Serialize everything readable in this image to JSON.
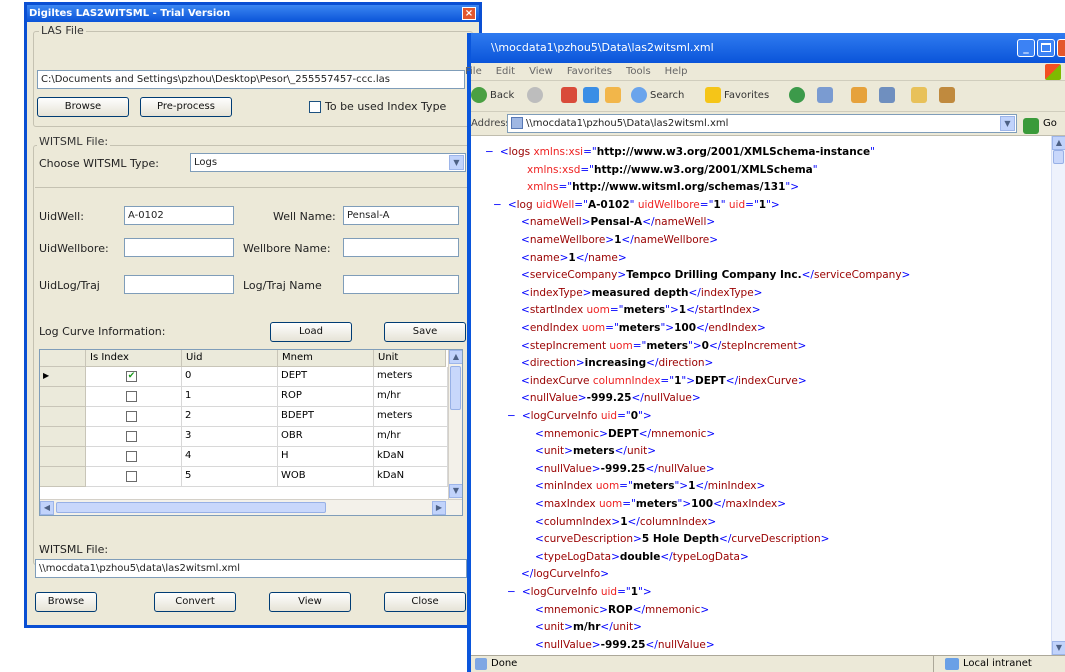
{
  "dialog": {
    "title": "Digiltes LAS2WITSML - Trial Version",
    "close_glyph": "×",
    "las_file": {
      "group_label": "LAS File",
      "path_value": "C:\\Documents and Settings\\pzhou\\Desktop\\Pesor\\_255557457-ccc.las",
      "browse_label": "Browse",
      "preprocess_label": "Pre-process",
      "checkbox_label": "To be used Index Type"
    },
    "witsml_file": {
      "group_label": "WITSML File:",
      "type_label": "Choose WITSML Type:",
      "type_value": "Logs",
      "uid_well_label": "UidWell:",
      "uid_well_value": "A-0102",
      "well_name_label": "Well Name:",
      "well_name_value": "Pensal-A",
      "uid_wellbore_label": "UidWellbore:",
      "uid_wellbore_value": "",
      "wellbore_name_label": "Wellbore Name:",
      "wellbore_name_value": "",
      "uid_logtraj_label": "UidLog/Traj",
      "uid_logtraj_value": "",
      "logtraj_name_label": "Log/Traj Name",
      "logtraj_name_value": ""
    },
    "curve_info": {
      "label": "Log Curve Information:",
      "load_label": "Load",
      "save_label": "Save",
      "columns": [
        "Is Index",
        "Uid",
        "Mnem",
        "Unit"
      ],
      "rows": [
        {
          "selected": true,
          "is_index": true,
          "uid": "0",
          "mnem": "DEPT",
          "unit": "meters"
        },
        {
          "selected": false,
          "is_index": false,
          "uid": "1",
          "mnem": "ROP",
          "unit": "m/hr"
        },
        {
          "selected": false,
          "is_index": false,
          "uid": "2",
          "mnem": "BDEPT",
          "unit": "meters"
        },
        {
          "selected": false,
          "is_index": false,
          "uid": "3",
          "mnem": "OBR",
          "unit": "m/hr"
        },
        {
          "selected": false,
          "is_index": false,
          "uid": "4",
          "mnem": "H",
          "unit": "kDaN"
        },
        {
          "selected": false,
          "is_index": false,
          "uid": "5",
          "mnem": "WOB",
          "unit": "kDaN"
        }
      ]
    },
    "output": {
      "label": "WITSML File:",
      "path_value": "\\\\mocdata1\\pzhou5\\data\\las2witsml.xml",
      "browse_label": "Browse",
      "convert_label": "Convert",
      "view_label": "View",
      "close_label": "Close"
    }
  },
  "browser": {
    "title": "\\\\mocdata1\\pzhou5\\Data\\las2witsml.xml",
    "menu": [
      "File",
      "Edit",
      "View",
      "Favorites",
      "Tools",
      "Help"
    ],
    "toolbar": {
      "back": "Back",
      "search": "Search",
      "favorites": "Favorites"
    },
    "address_label": "Address",
    "address_value": "\\\\mocdata1\\pzhou5\\Data\\las2witsml.xml",
    "go_label": "Go",
    "status_left": "Done",
    "status_right": "Local intranet",
    "xml_lines": [
      [
        {
          "c": "mk",
          "t": "<"
        },
        {
          "c": "tg",
          "t": "logs "
        },
        {
          "c": "at",
          "t": "xmlns:xsi"
        },
        {
          "c": "mk",
          "t": "=\""
        },
        {
          "c": "av",
          "t": "http://www.w3.org/2001/XMLSchema-instance"
        },
        {
          "c": "mk",
          "t": "\""
        }
      ],
      [
        {
          "c": "at",
          "t": "xmlns:xsd"
        },
        {
          "c": "mk",
          "t": "=\""
        },
        {
          "c": "av",
          "t": "http://www.w3.org/2001/XMLSchema"
        },
        {
          "c": "mk",
          "t": "\""
        }
      ],
      [
        {
          "c": "at",
          "t": "xmlns"
        },
        {
          "c": "mk",
          "t": "=\""
        },
        {
          "c": "av",
          "t": "http://www.witsml.org/schemas/131"
        },
        {
          "c": "mk",
          "t": "\">"
        }
      ],
      [
        {
          "c": "mk",
          "t": "<"
        },
        {
          "c": "tg",
          "t": "log "
        },
        {
          "c": "at",
          "t": "uidWell"
        },
        {
          "c": "mk",
          "t": "=\""
        },
        {
          "c": "av",
          "t": "A-0102"
        },
        {
          "c": "mk",
          "t": "\" "
        },
        {
          "c": "at",
          "t": "uidWellbore"
        },
        {
          "c": "mk",
          "t": "=\""
        },
        {
          "c": "av",
          "t": "1"
        },
        {
          "c": "mk",
          "t": "\" "
        },
        {
          "c": "at",
          "t": "uid"
        },
        {
          "c": "mk",
          "t": "=\""
        },
        {
          "c": "av",
          "t": "1"
        },
        {
          "c": "mk",
          "t": "\">"
        }
      ],
      [
        {
          "c": "mk",
          "t": "<"
        },
        {
          "c": "tg",
          "t": "nameWell"
        },
        {
          "c": "mk",
          "t": ">"
        },
        {
          "c": "tx",
          "t": "Pensal-A"
        },
        {
          "c": "mk",
          "t": "</"
        },
        {
          "c": "tg",
          "t": "nameWell"
        },
        {
          "c": "mk",
          "t": ">"
        }
      ],
      [
        {
          "c": "mk",
          "t": "<"
        },
        {
          "c": "tg",
          "t": "nameWellbore"
        },
        {
          "c": "mk",
          "t": ">"
        },
        {
          "c": "tx",
          "t": "1"
        },
        {
          "c": "mk",
          "t": "</"
        },
        {
          "c": "tg",
          "t": "nameWellbore"
        },
        {
          "c": "mk",
          "t": ">"
        }
      ],
      [
        {
          "c": "mk",
          "t": "<"
        },
        {
          "c": "tg",
          "t": "name"
        },
        {
          "c": "mk",
          "t": ">"
        },
        {
          "c": "tx",
          "t": "1"
        },
        {
          "c": "mk",
          "t": "</"
        },
        {
          "c": "tg",
          "t": "name"
        },
        {
          "c": "mk",
          "t": ">"
        }
      ],
      [
        {
          "c": "mk",
          "t": "<"
        },
        {
          "c": "tg",
          "t": "serviceCompany"
        },
        {
          "c": "mk",
          "t": ">"
        },
        {
          "c": "tx",
          "t": "Tempco Drilling Company Inc."
        },
        {
          "c": "mk",
          "t": "</"
        },
        {
          "c": "tg",
          "t": "serviceCompany"
        },
        {
          "c": "mk",
          "t": ">"
        }
      ],
      [
        {
          "c": "mk",
          "t": "<"
        },
        {
          "c": "tg",
          "t": "indexType"
        },
        {
          "c": "mk",
          "t": ">"
        },
        {
          "c": "tx",
          "t": "measured depth"
        },
        {
          "c": "mk",
          "t": "</"
        },
        {
          "c": "tg",
          "t": "indexType"
        },
        {
          "c": "mk",
          "t": ">"
        }
      ],
      [
        {
          "c": "mk",
          "t": "<"
        },
        {
          "c": "tg",
          "t": "startIndex "
        },
        {
          "c": "at",
          "t": "uom"
        },
        {
          "c": "mk",
          "t": "=\""
        },
        {
          "c": "av",
          "t": "meters"
        },
        {
          "c": "mk",
          "t": "\">"
        },
        {
          "c": "tx",
          "t": "1"
        },
        {
          "c": "mk",
          "t": "</"
        },
        {
          "c": "tg",
          "t": "startIndex"
        },
        {
          "c": "mk",
          "t": ">"
        }
      ],
      [
        {
          "c": "mk",
          "t": "<"
        },
        {
          "c": "tg",
          "t": "endIndex "
        },
        {
          "c": "at",
          "t": "uom"
        },
        {
          "c": "mk",
          "t": "=\""
        },
        {
          "c": "av",
          "t": "meters"
        },
        {
          "c": "mk",
          "t": "\">"
        },
        {
          "c": "tx",
          "t": "100"
        },
        {
          "c": "mk",
          "t": "</"
        },
        {
          "c": "tg",
          "t": "endIndex"
        },
        {
          "c": "mk",
          "t": ">"
        }
      ],
      [
        {
          "c": "mk",
          "t": "<"
        },
        {
          "c": "tg",
          "t": "stepIncrement "
        },
        {
          "c": "at",
          "t": "uom"
        },
        {
          "c": "mk",
          "t": "=\""
        },
        {
          "c": "av",
          "t": "meters"
        },
        {
          "c": "mk",
          "t": "\">"
        },
        {
          "c": "tx",
          "t": "0"
        },
        {
          "c": "mk",
          "t": "</"
        },
        {
          "c": "tg",
          "t": "stepIncrement"
        },
        {
          "c": "mk",
          "t": ">"
        }
      ],
      [
        {
          "c": "mk",
          "t": "<"
        },
        {
          "c": "tg",
          "t": "direction"
        },
        {
          "c": "mk",
          "t": ">"
        },
        {
          "c": "tx",
          "t": "increasing"
        },
        {
          "c": "mk",
          "t": "</"
        },
        {
          "c": "tg",
          "t": "direction"
        },
        {
          "c": "mk",
          "t": ">"
        }
      ],
      [
        {
          "c": "mk",
          "t": "<"
        },
        {
          "c": "tg",
          "t": "indexCurve "
        },
        {
          "c": "at",
          "t": "columnIndex"
        },
        {
          "c": "mk",
          "t": "=\""
        },
        {
          "c": "av",
          "t": "1"
        },
        {
          "c": "mk",
          "t": "\">"
        },
        {
          "c": "tx",
          "t": "DEPT"
        },
        {
          "c": "mk",
          "t": "</"
        },
        {
          "c": "tg",
          "t": "indexCurve"
        },
        {
          "c": "mk",
          "t": ">"
        }
      ],
      [
        {
          "c": "mk",
          "t": "<"
        },
        {
          "c": "tg",
          "t": "nullValue"
        },
        {
          "c": "mk",
          "t": ">"
        },
        {
          "c": "tx",
          "t": "-999.25"
        },
        {
          "c": "mk",
          "t": "</"
        },
        {
          "c": "tg",
          "t": "nullValue"
        },
        {
          "c": "mk",
          "t": ">"
        }
      ],
      [
        {
          "c": "mk",
          "t": "<"
        },
        {
          "c": "tg",
          "t": "logCurveInfo "
        },
        {
          "c": "at",
          "t": "uid"
        },
        {
          "c": "mk",
          "t": "=\""
        },
        {
          "c": "av",
          "t": "0"
        },
        {
          "c": "mk",
          "t": "\">"
        }
      ],
      [
        {
          "c": "mk",
          "t": "<"
        },
        {
          "c": "tg",
          "t": "mnemonic"
        },
        {
          "c": "mk",
          "t": ">"
        },
        {
          "c": "tx",
          "t": "DEPT"
        },
        {
          "c": "mk",
          "t": "</"
        },
        {
          "c": "tg",
          "t": "mnemonic"
        },
        {
          "c": "mk",
          "t": ">"
        }
      ],
      [
        {
          "c": "mk",
          "t": "<"
        },
        {
          "c": "tg",
          "t": "unit"
        },
        {
          "c": "mk",
          "t": ">"
        },
        {
          "c": "tx",
          "t": "meters"
        },
        {
          "c": "mk",
          "t": "</"
        },
        {
          "c": "tg",
          "t": "unit"
        },
        {
          "c": "mk",
          "t": ">"
        }
      ],
      [
        {
          "c": "mk",
          "t": "<"
        },
        {
          "c": "tg",
          "t": "nullValue"
        },
        {
          "c": "mk",
          "t": ">"
        },
        {
          "c": "tx",
          "t": "-999.25"
        },
        {
          "c": "mk",
          "t": "</"
        },
        {
          "c": "tg",
          "t": "nullValue"
        },
        {
          "c": "mk",
          "t": ">"
        }
      ],
      [
        {
          "c": "mk",
          "t": "<"
        },
        {
          "c": "tg",
          "t": "minIndex "
        },
        {
          "c": "at",
          "t": "uom"
        },
        {
          "c": "mk",
          "t": "=\""
        },
        {
          "c": "av",
          "t": "meters"
        },
        {
          "c": "mk",
          "t": "\">"
        },
        {
          "c": "tx",
          "t": "1"
        },
        {
          "c": "mk",
          "t": "</"
        },
        {
          "c": "tg",
          "t": "minIndex"
        },
        {
          "c": "mk",
          "t": ">"
        }
      ],
      [
        {
          "c": "mk",
          "t": "<"
        },
        {
          "c": "tg",
          "t": "maxIndex "
        },
        {
          "c": "at",
          "t": "uom"
        },
        {
          "c": "mk",
          "t": "=\""
        },
        {
          "c": "av",
          "t": "meters"
        },
        {
          "c": "mk",
          "t": "\">"
        },
        {
          "c": "tx",
          "t": "100"
        },
        {
          "c": "mk",
          "t": "</"
        },
        {
          "c": "tg",
          "t": "maxIndex"
        },
        {
          "c": "mk",
          "t": ">"
        }
      ],
      [
        {
          "c": "mk",
          "t": "<"
        },
        {
          "c": "tg",
          "t": "columnIndex"
        },
        {
          "c": "mk",
          "t": ">"
        },
        {
          "c": "tx",
          "t": "1"
        },
        {
          "c": "mk",
          "t": "</"
        },
        {
          "c": "tg",
          "t": "columnIndex"
        },
        {
          "c": "mk",
          "t": ">"
        }
      ],
      [
        {
          "c": "mk",
          "t": "<"
        },
        {
          "c": "tg",
          "t": "curveDescription"
        },
        {
          "c": "mk",
          "t": ">"
        },
        {
          "c": "tx",
          "t": "5 Hole Depth"
        },
        {
          "c": "mk",
          "t": "</"
        },
        {
          "c": "tg",
          "t": "curveDescription"
        },
        {
          "c": "mk",
          "t": ">"
        }
      ],
      [
        {
          "c": "mk",
          "t": "<"
        },
        {
          "c": "tg",
          "t": "typeLogData"
        },
        {
          "c": "mk",
          "t": ">"
        },
        {
          "c": "tx",
          "t": "double"
        },
        {
          "c": "mk",
          "t": "</"
        },
        {
          "c": "tg",
          "t": "typeLogData"
        },
        {
          "c": "mk",
          "t": ">"
        }
      ],
      [
        {
          "c": "mk",
          "t": "</"
        },
        {
          "c": "tg",
          "t": "logCurveInfo"
        },
        {
          "c": "mk",
          "t": ">"
        }
      ],
      [
        {
          "c": "mk",
          "t": "<"
        },
        {
          "c": "tg",
          "t": "logCurveInfo "
        },
        {
          "c": "at",
          "t": "uid"
        },
        {
          "c": "mk",
          "t": "=\""
        },
        {
          "c": "av",
          "t": "1"
        },
        {
          "c": "mk",
          "t": "\">"
        }
      ],
      [
        {
          "c": "mk",
          "t": "<"
        },
        {
          "c": "tg",
          "t": "mnemonic"
        },
        {
          "c": "mk",
          "t": ">"
        },
        {
          "c": "tx",
          "t": "ROP"
        },
        {
          "c": "mk",
          "t": "</"
        },
        {
          "c": "tg",
          "t": "mnemonic"
        },
        {
          "c": "mk",
          "t": ">"
        }
      ],
      [
        {
          "c": "mk",
          "t": "<"
        },
        {
          "c": "tg",
          "t": "unit"
        },
        {
          "c": "mk",
          "t": ">"
        },
        {
          "c": "tx",
          "t": "m/hr"
        },
        {
          "c": "mk",
          "t": "</"
        },
        {
          "c": "tg",
          "t": "unit"
        },
        {
          "c": "mk",
          "t": ">"
        }
      ],
      [
        {
          "c": "mk",
          "t": "<"
        },
        {
          "c": "tg",
          "t": "nullValue"
        },
        {
          "c": "mk",
          "t": ">"
        },
        {
          "c": "tx",
          "t": "-999.25"
        },
        {
          "c": "mk",
          "t": "</"
        },
        {
          "c": "tg",
          "t": "nullValue"
        },
        {
          "c": "mk",
          "t": ">"
        }
      ]
    ],
    "xml_minus_glyph": "−"
  }
}
